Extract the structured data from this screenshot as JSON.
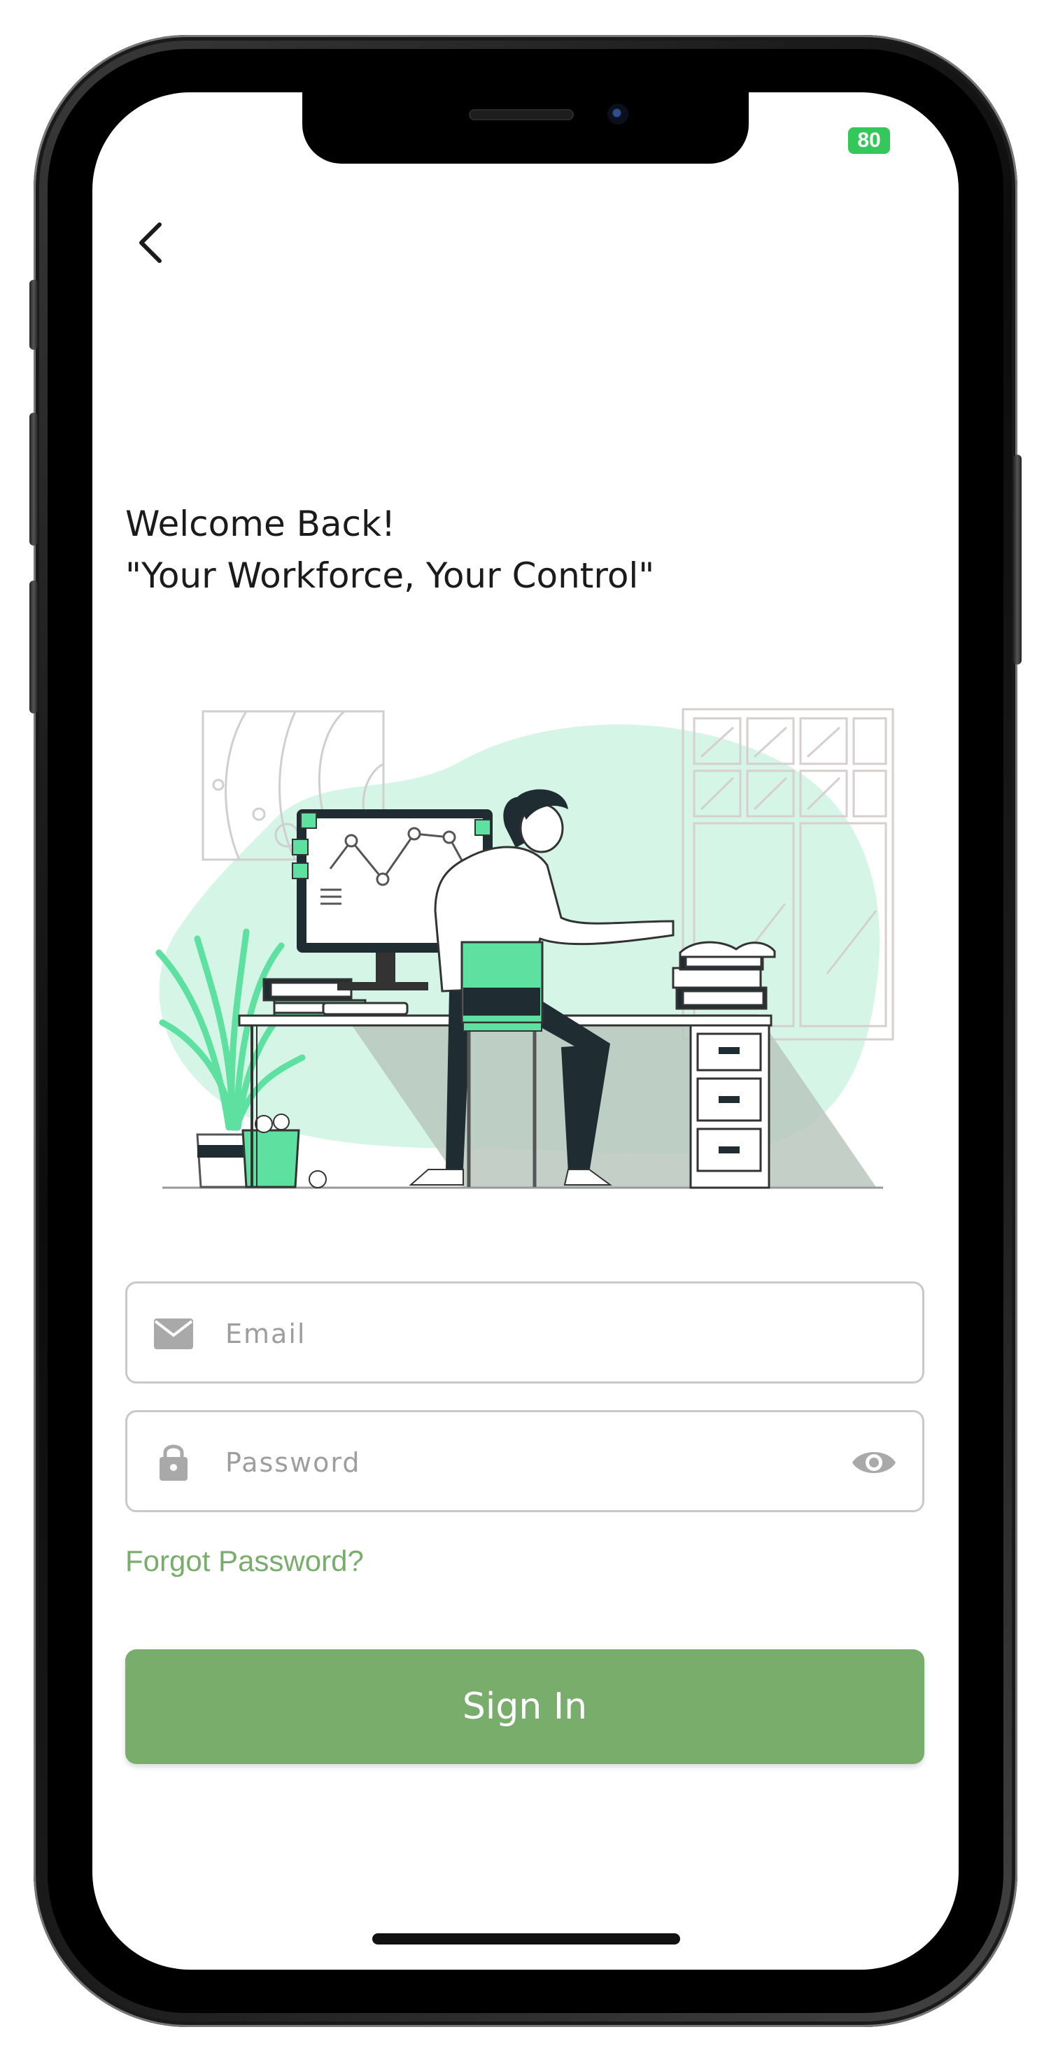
{
  "status_bar": {
    "battery_label": "80"
  },
  "header": {
    "line1": "Welcome Back!",
    "line2": "\"Your Workforce, Your Control\""
  },
  "form": {
    "email": {
      "placeholder": "Email",
      "value": ""
    },
    "password": {
      "placeholder": "Password",
      "value": ""
    },
    "forgot_label": "Forgot Password?",
    "submit_label": "Sign In"
  },
  "icons": {
    "back": "chevron-left-icon",
    "email": "mail-icon",
    "password": "lock-icon",
    "visibility": "eye-icon"
  },
  "colors": {
    "accent": "#79ad6c",
    "illustration_green": "#5ee0a0",
    "illustration_mint": "#d5f5e6",
    "battery": "#34c759"
  }
}
